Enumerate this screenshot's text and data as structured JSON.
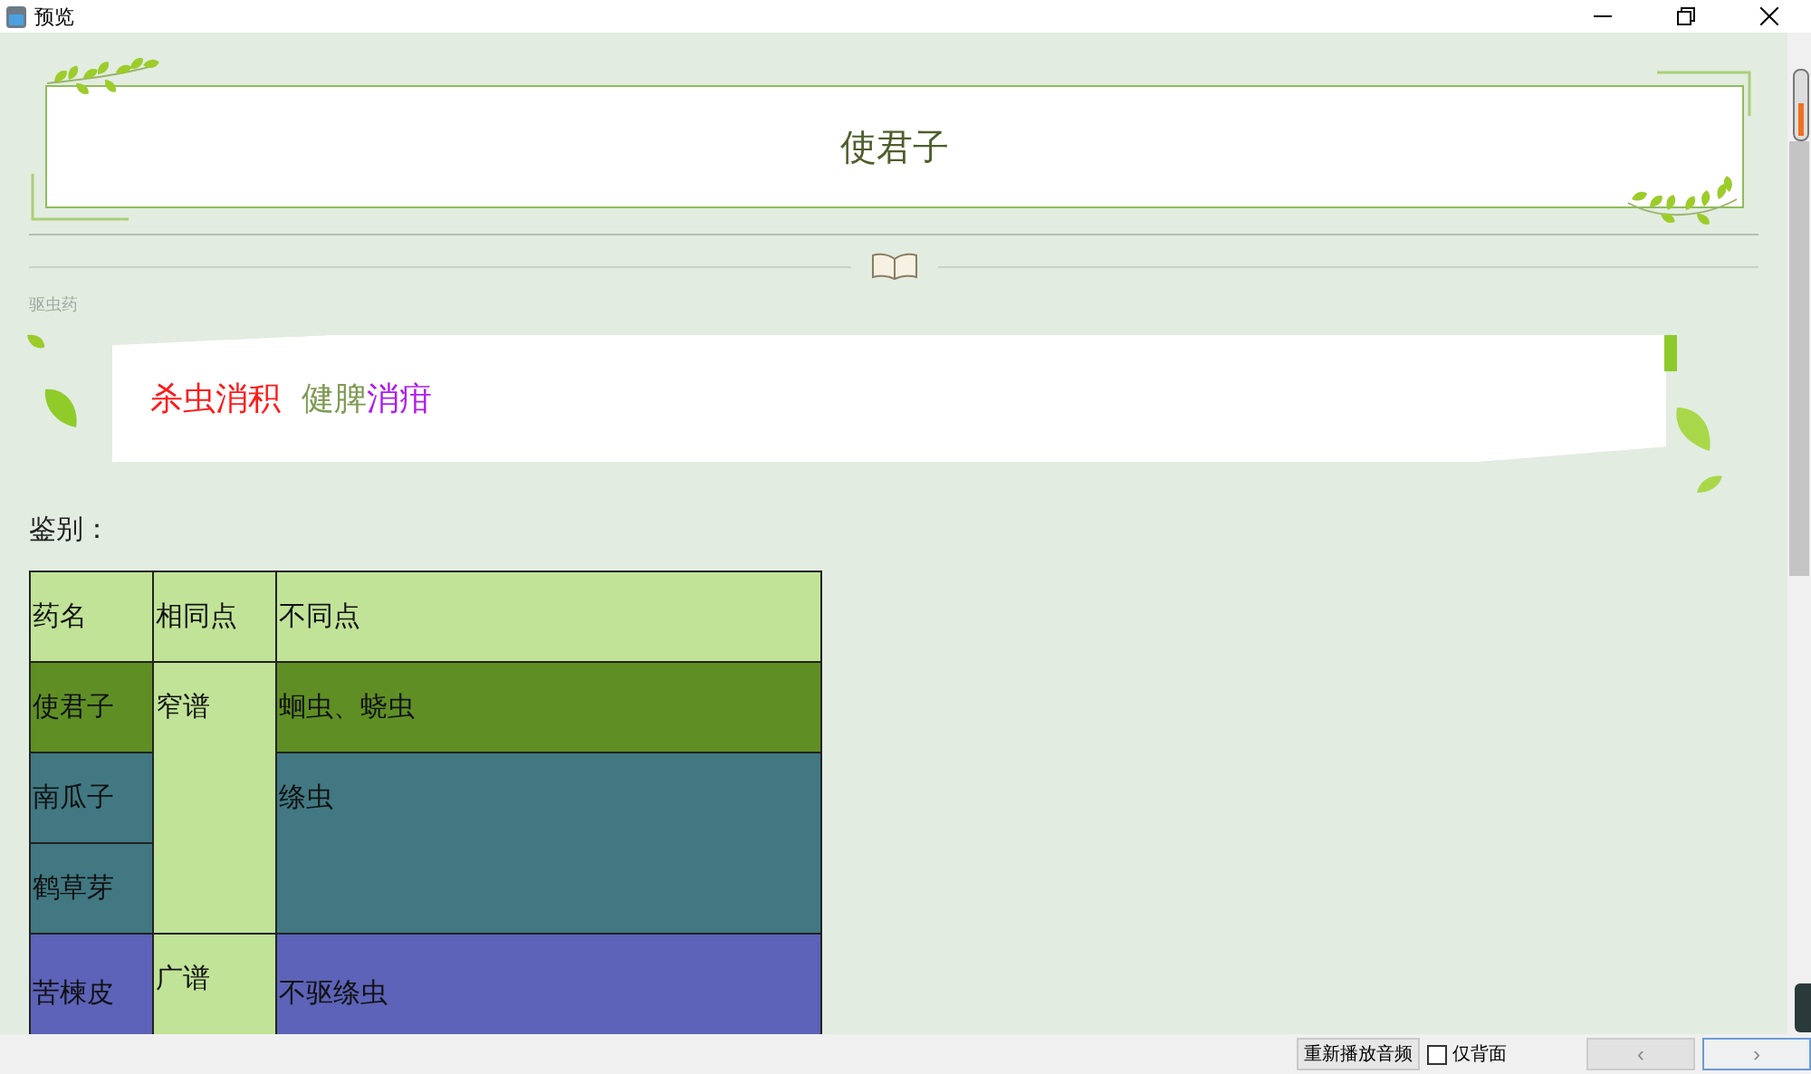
{
  "window": {
    "title": "预览"
  },
  "header": {
    "title": "使君子"
  },
  "category": "驱虫药",
  "efficacy": [
    {
      "text": "杀虫消积",
      "color": "#ff1a1a"
    },
    {
      "text": "健脾",
      "color": "#7d9a52"
    },
    {
      "text": "消疳",
      "color": "#b01cf0"
    }
  ],
  "identify_label": "鉴别：",
  "table": {
    "columns": [
      "药名",
      "相同点",
      "不同点"
    ],
    "groups": [
      {
        "same": "窄谱",
        "subgroups": [
          {
            "diff": "蛔虫、蛲虫",
            "color": "#5f8f24",
            "names": [
              "使君子"
            ]
          },
          {
            "diff": "绦虫",
            "color": "#417882",
            "names": [
              "南瓜子",
              "鹤草芽"
            ]
          }
        ]
      },
      {
        "same": "广谱",
        "subgroups": [
          {
            "diff": "不驱绦虫",
            "color": "#5c63b8",
            "names": [
              "苦楝皮"
            ]
          }
        ]
      }
    ]
  },
  "bottom_bar": {
    "replay_button": "重新播放音频",
    "back_only": {
      "label": "仅背面",
      "checked": false
    },
    "prev_button": "‹",
    "next_button": "›"
  }
}
